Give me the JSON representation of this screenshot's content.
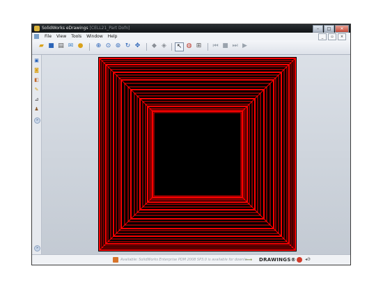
{
  "window": {
    "app_name": "SolidWorks eDrawings",
    "document_name": "[CELL21_Part Dofn]"
  },
  "title_buttons": {
    "minimize": "–",
    "maximize": "□",
    "close": "✕"
  },
  "menu": {
    "items": [
      "File",
      "View",
      "Tools",
      "Window",
      "Help"
    ]
  },
  "mdi_buttons": {
    "minimize": "_",
    "restore": "▫",
    "close": "×"
  },
  "toolbar": {
    "groups": [
      [
        "open-icon",
        "save-icon",
        "print-icon",
        "send-icon",
        "help-icon"
      ],
      [
        "zoom-in-icon",
        "zoom-area-icon",
        "zoom-fit-icon",
        "rotate-icon",
        "pan-icon"
      ],
      [
        "shaded-icon",
        "wireframe-icon"
      ],
      [
        "select-icon",
        "sheet-icon",
        "measure-icon"
      ],
      [
        "first-icon",
        "stop-icon",
        "play-next-icon",
        "play-icon"
      ]
    ]
  },
  "left_panel": {
    "icons": [
      "sheets-icon",
      "markup-icon",
      "layers-icon",
      "pencil-icon",
      "measure-tool-icon",
      "stamp-icon"
    ],
    "expand_top": "»",
    "expand_bottom": "»"
  },
  "status": {
    "message": "Available: SolidWorks Enterprise PDM 2008 SP3.0 is available for downlo...",
    "arrow": "⟶",
    "brand": "DRAWINGS®",
    "brand_suffix": "◂Ə"
  },
  "colors": {
    "drawing_background": "#000000",
    "drawing_lines": "#ff0000"
  }
}
